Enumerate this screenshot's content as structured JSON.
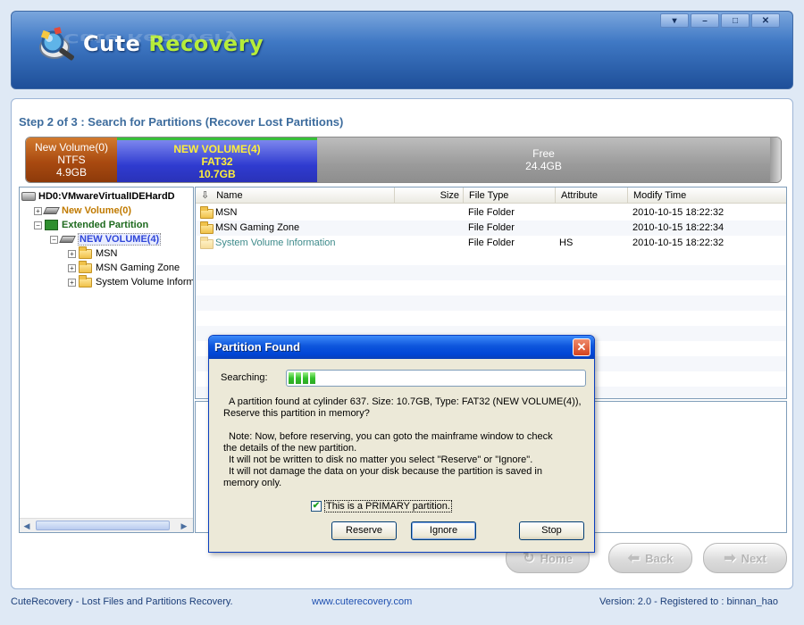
{
  "app": {
    "title_main": "Cute",
    "title_accent": "Recovery",
    "window_buttons": [
      "▾",
      "–",
      "□",
      "✕"
    ]
  },
  "step_title": "Step 2 of 3 : Search for Partitions (Recover Lost Partitions)",
  "partition_bar": [
    {
      "name": "New Volume(0)",
      "fs": "NTFS",
      "size": "4.9GB",
      "color": "#a94a10"
    },
    {
      "name": "NEW VOLUME(4)",
      "fs": "FAT32",
      "size": "10.7GB",
      "color": "#2f3bd0"
    },
    {
      "name": "Free",
      "fs": "",
      "size": "24.4GB",
      "color": "#9b9b9b"
    }
  ],
  "tree": {
    "root": "HD0:VMwareVirtualIDEHardD",
    "vol0": "New Volume(0)",
    "extended": "Extended Partition",
    "vol4": "NEW VOLUME(4)",
    "folders": [
      "MSN",
      "MSN Gaming Zone",
      "System Volume Inform"
    ]
  },
  "list": {
    "columns": [
      "Name",
      "Size",
      "File Type",
      "Attribute",
      "Modify Time"
    ],
    "rows": [
      {
        "name": "MSN",
        "size": "",
        "type": "File Folder",
        "attr": "",
        "time": "2010-10-15 18:22:32"
      },
      {
        "name": "MSN Gaming Zone",
        "size": "",
        "type": "File Folder",
        "attr": "",
        "time": "2010-10-15 18:22:34"
      },
      {
        "name": "System Volume Information",
        "size": "",
        "type": "File Folder",
        "attr": "HS",
        "time": "2010-10-15 18:22:32"
      }
    ]
  },
  "nav": {
    "home": "Home",
    "back": "Back",
    "next": "Next"
  },
  "footer": {
    "left": "CuteRecovery - Lost Files and Partitions Recovery.",
    "center": "www.cuterecovery.com",
    "right": "Version: 2.0 - Registered to : binnan_hao"
  },
  "dialog": {
    "title": "Partition Found",
    "searching_label": "Searching:",
    "progress": 0.1,
    "message_line1": "A partition found at cylinder 637. Size: 10.7GB, Type: FAT32 (NEW VOLUME(4)),",
    "message_line2": "Reserve this partition in memory?",
    "note_line1": "Note: Now, before reserving, you can goto the mainframe window to check",
    "note_line2": "the details of the new partition.",
    "note_line3": "It will not be written to disk no matter you select \"Reserve\" or \"Ignore\".",
    "note_line4": "It will not damage the data on your disk because the partition is saved in",
    "note_line5": "memory only.",
    "checkbox_label": "This is a PRIMARY partition.",
    "checkbox_checked": true,
    "reserve": "Reserve",
    "ignore": "Ignore",
    "stop": "Stop"
  }
}
